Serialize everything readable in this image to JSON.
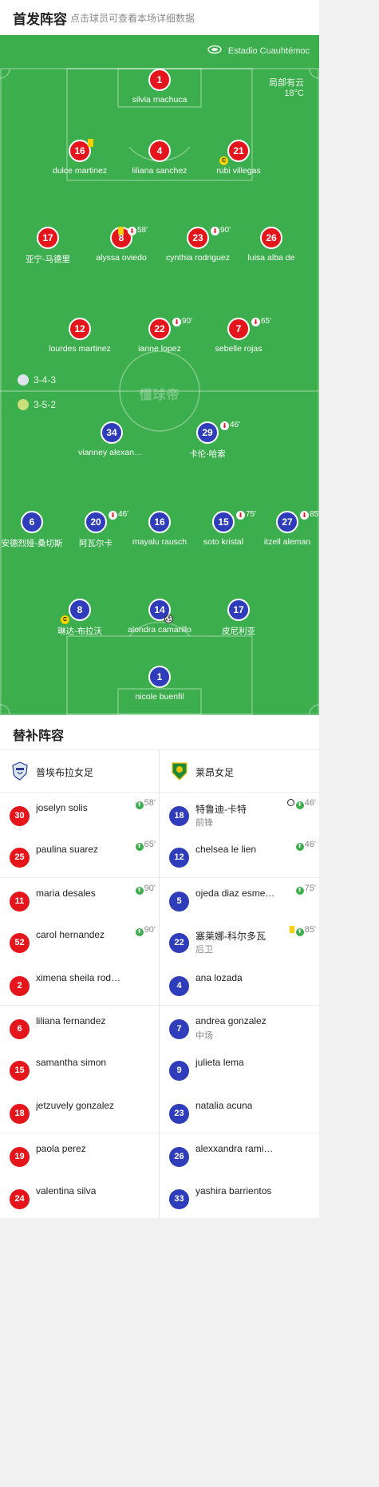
{
  "header": {
    "title": "首发阵容",
    "subtitle": "点击球员可查看本场详细数据"
  },
  "pitch": {
    "stadium": "Estadio Cuauhtémoc",
    "weather_desc": "局部有云",
    "weather_temp": "18°C",
    "watermark": "懂球帝",
    "home_formation": "3-4-3",
    "away_formation": "3-5-2",
    "colors": {
      "pitch": "#3cae4d",
      "home": "#e5151c",
      "away": "#2f3dba"
    },
    "home_players": [
      {
        "num": "1",
        "name": "silvia machuca"
      },
      {
        "num": "16",
        "name": "dulce martinez",
        "yellow": true
      },
      {
        "num": "4",
        "name": "liliana sanchez"
      },
      {
        "num": "21",
        "name": "rubi villegas",
        "captain": true
      },
      {
        "num": "17",
        "name": "亚宁-马德里"
      },
      {
        "num": "8",
        "name": "alyssa oviedo",
        "yellow": true,
        "sub_off": "58'"
      },
      {
        "num": "23",
        "name": "cynthia rodriguez",
        "sub_off": "90'"
      },
      {
        "num": "26",
        "name": "luisa alba de"
      },
      {
        "num": "12",
        "name": "lourdes martinez"
      },
      {
        "num": "22",
        "name": "ianne lopez",
        "sub_off": "90'"
      },
      {
        "num": "7",
        "name": "sebelle rojas",
        "sub_off": "65'"
      }
    ],
    "away_players": [
      {
        "num": "34",
        "name": "vianney alexander"
      },
      {
        "num": "29",
        "name": "卡伦-哈索",
        "sub_off": "46'"
      },
      {
        "num": "6",
        "name": "安德烈娅-桑切斯"
      },
      {
        "num": "20",
        "name": "阿瓦尔卡",
        "sub_off": "46'"
      },
      {
        "num": "16",
        "name": "mayalu rausch"
      },
      {
        "num": "15",
        "name": "soto kristal",
        "sub_off": "75'"
      },
      {
        "num": "27",
        "name": "itzell aleman",
        "sub_off": "85'"
      },
      {
        "num": "8",
        "name": "琳达-布拉沃",
        "captain": true
      },
      {
        "num": "14",
        "name": "alondra camarillo",
        "goal": true
      },
      {
        "num": "17",
        "name": "皮尼利亚"
      },
      {
        "num": "1",
        "name": "nicole buenfil"
      }
    ],
    "captain_mark": "C"
  },
  "subs": {
    "title": "替补阵容",
    "home": {
      "team": "普埃布拉女足",
      "players": [
        {
          "num": "30",
          "name": "joselyn solis",
          "in": "58'"
        },
        {
          "num": "25",
          "name": "paulina suarez",
          "in": "65'"
        },
        {
          "num": "11",
          "name": "maria desales",
          "in": "90'"
        },
        {
          "num": "52",
          "name": "carol hernandez",
          "in": "90'"
        },
        {
          "num": "2",
          "name": "ximena sheila rodriguez"
        },
        {
          "num": "6",
          "name": "liliana fernandez"
        },
        {
          "num": "15",
          "name": "samantha simon"
        },
        {
          "num": "18",
          "name": "jetzuvely gonzalez"
        },
        {
          "num": "19",
          "name": "paola perez"
        },
        {
          "num": "24",
          "name": "valentina silva"
        }
      ]
    },
    "away": {
      "team": "莱昂女足",
      "players": [
        {
          "num": "18",
          "name": "特鲁迪-卡特",
          "pos": "前锋",
          "in": "46'",
          "goal": true
        },
        {
          "num": "12",
          "name": "chelsea le lien",
          "in": "46'"
        },
        {
          "num": "5",
          "name": "ojeda diaz esmeralda",
          "in": "75'"
        },
        {
          "num": "22",
          "name": "塞莱娜-科尔多瓦",
          "pos": "后卫",
          "in": "85'",
          "yellow": true
        },
        {
          "num": "4",
          "name": "ana lozada"
        },
        {
          "num": "7",
          "name": "andrea gonzalez",
          "pos": "中场"
        },
        {
          "num": "9",
          "name": "julieta lema"
        },
        {
          "num": "23",
          "name": "natalia acuna"
        },
        {
          "num": "26",
          "name": "alexxandra ramirez"
        },
        {
          "num": "33",
          "name": "yashira barrientos"
        }
      ]
    }
  }
}
